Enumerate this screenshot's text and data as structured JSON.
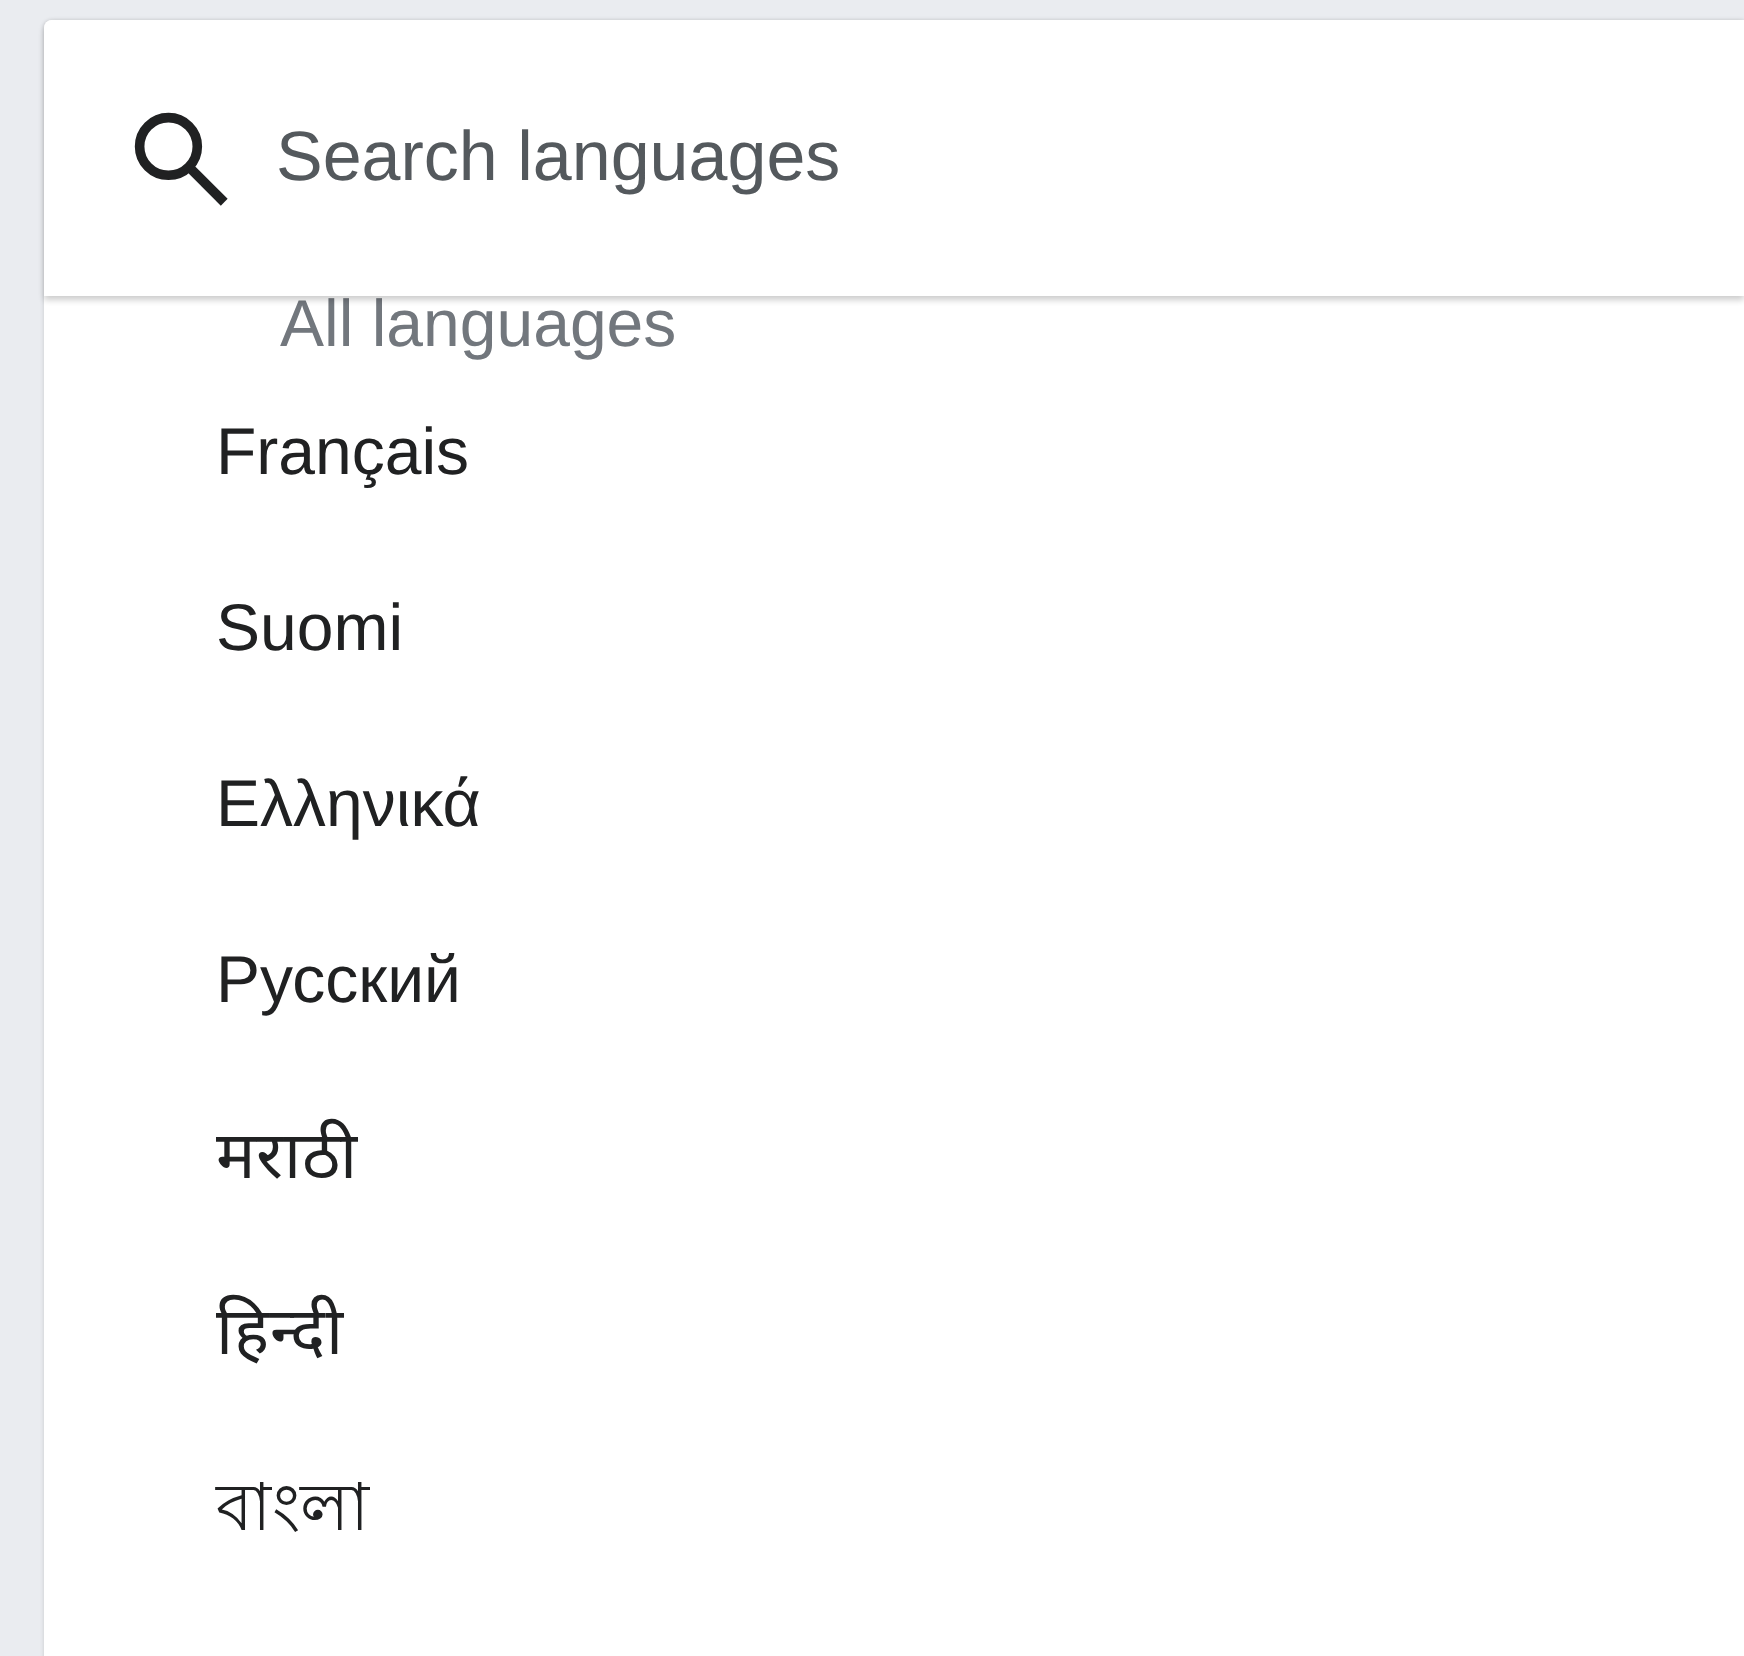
{
  "search": {
    "placeholder": "Search languages"
  },
  "section_heading": "All languages",
  "languages": [
    {
      "label": "Français"
    },
    {
      "label": "Suomi"
    },
    {
      "label": "Ελληνικά"
    },
    {
      "label": "Русский"
    },
    {
      "label": "मराठी"
    },
    {
      "label": "हिन्दी"
    },
    {
      "label": "বাংলা"
    }
  ]
}
